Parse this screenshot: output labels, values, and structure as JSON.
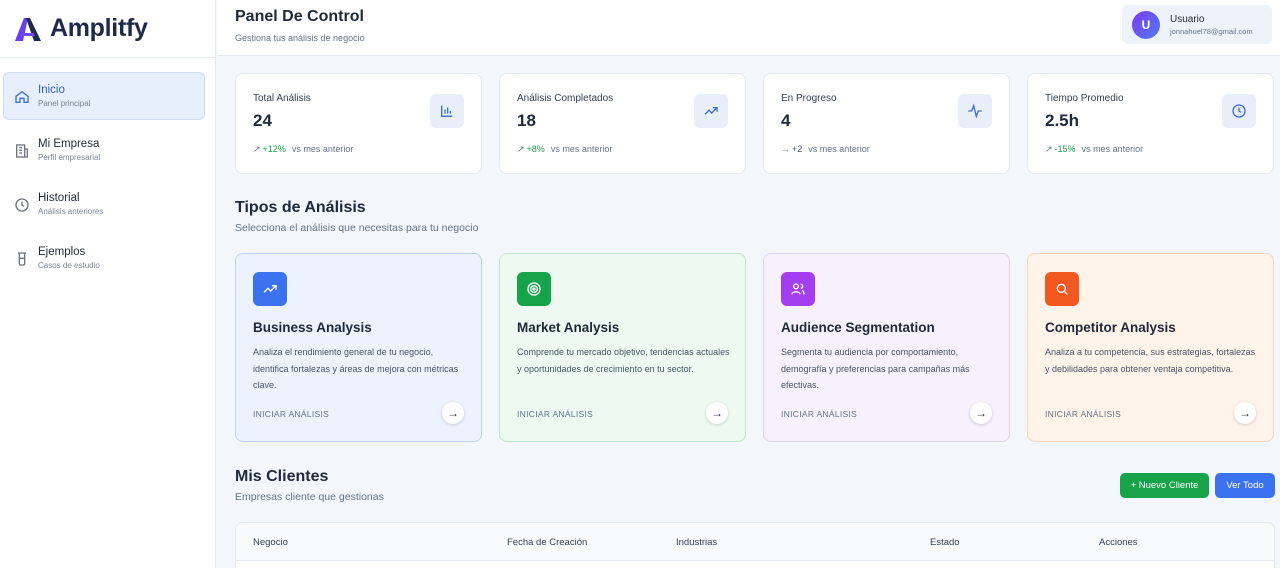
{
  "brand": {
    "name": "Amplitfy"
  },
  "sidebar": {
    "items": [
      {
        "label": "Inicio",
        "sub": "Panel principal",
        "icon": "home-icon",
        "active": true
      },
      {
        "label": "Mi Empresa",
        "sub": "Perfil empresarial",
        "icon": "building-icon",
        "active": false
      },
      {
        "label": "Historial",
        "sub": "Análisis anteriores",
        "icon": "clock-icon",
        "active": false
      },
      {
        "label": "Ejemplos",
        "sub": "Casos de estudio",
        "icon": "flask-icon",
        "active": false
      }
    ]
  },
  "header": {
    "title": "Panel De Control",
    "subtitle": "Gestiona tus análisis de negocio",
    "user": {
      "initial": "U",
      "name": "Usuario",
      "email": "jonnahuel78@gmail.com"
    }
  },
  "stats": [
    {
      "label": "Total Análisis",
      "value": "24",
      "arrow": "↗",
      "delta": "+12%",
      "vs": "vs mes anterior",
      "icon": "bar-chart-icon"
    },
    {
      "label": "Análisis Completados",
      "value": "18",
      "arrow": "↗",
      "delta": "+8%",
      "vs": "vs mes anterior",
      "icon": "trending-up-icon"
    },
    {
      "label": "En Progreso",
      "value": "4",
      "arrow": "→",
      "delta": "+2",
      "vs": "vs mes anterior",
      "icon": "activity-icon"
    },
    {
      "label": "Tiempo Promedio",
      "value": "2.5h",
      "arrow": "↗",
      "delta": "-15%",
      "vs": "vs mes anterior",
      "icon": "clock-icon"
    }
  ],
  "analysis": {
    "title": "Tipos de Análisis",
    "subtitle": "Selecciona el análisis que necesitas para tu negocio",
    "cta": "INICIAR ANÁLISIS",
    "go": "→",
    "cards": [
      {
        "title": "Business Analysis",
        "description": "Analiza el rendimiento general de tu negocio, identifica fortalezas y áreas de mejora con métricas clave.",
        "icon": "trending-up-icon",
        "accent": "#3b72ef",
        "bg": "#edf3fd",
        "border": "#bcd3f5"
      },
      {
        "title": "Market Analysis",
        "description": "Comprende tu mercado objetivo, tendencias actuales y oportunidades de crecimiento en tu sector.",
        "icon": "target-icon",
        "accent": "#16a34a",
        "bg": "#eefaf1",
        "border": "#bde8c9"
      },
      {
        "title": "Audience Segmentation",
        "description": "Segmenta tu audiencia por comportamiento, demografía y preferencias para campañas más efectivas.",
        "icon": "users-icon",
        "accent": "#a43ef0",
        "bg": "#f7f1fd",
        "border": "#e3cff7"
      },
      {
        "title": "Competitor Analysis",
        "description": "Analiza a tu competencia, sus estrategias, fortalezas y debilidades para obtener ventaja competitiva.",
        "icon": "search-icon",
        "accent": "#f2581f",
        "bg": "#fff3ea",
        "border": "#f8d6bd"
      }
    ]
  },
  "clients": {
    "title": "Mis Clientes",
    "subtitle": "Empresas cliente que gestionas",
    "new_label": "+ Nuevo Cliente",
    "view_all_label": "Ver Todo",
    "columns": [
      "Negocio",
      "Fecha de Creación",
      "Industrias",
      "Estado",
      "Acciones"
    ]
  }
}
